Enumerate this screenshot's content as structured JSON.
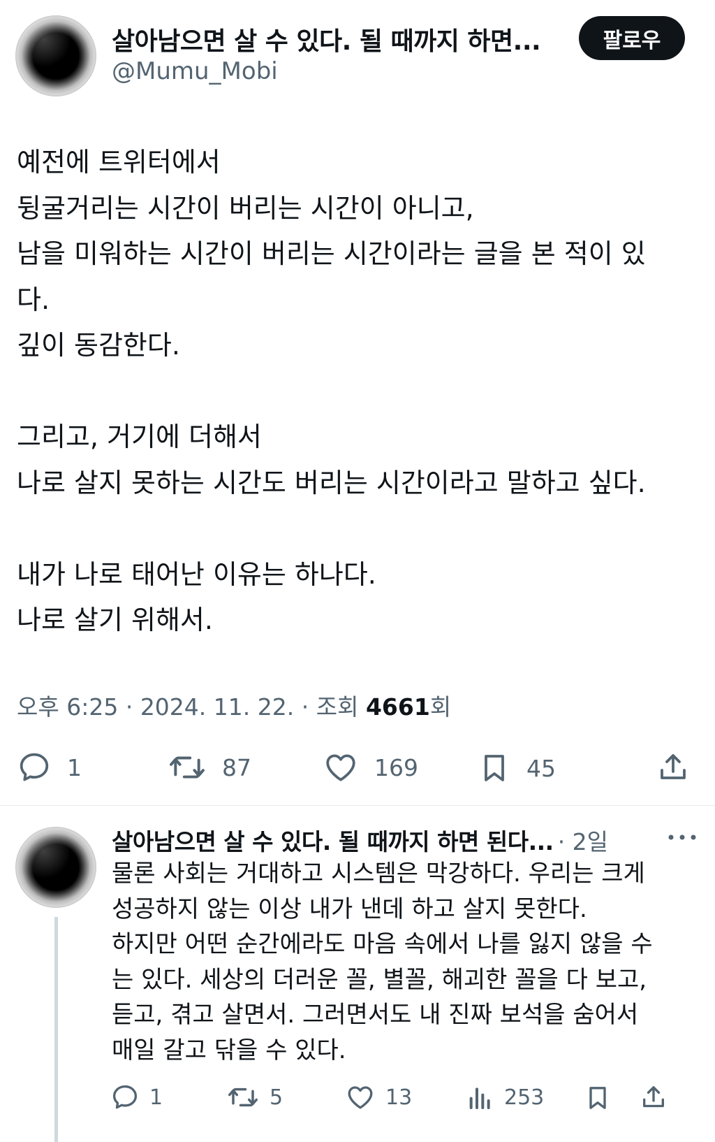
{
  "tweet": {
    "display_name": "살아남으면 살 수 있다. 될 때까지 하면...",
    "handle": "@Mumu_Mobi",
    "follow_label": "팔로우",
    "lines": [
      "예전에 트위터에서",
      "뒹굴거리는 시간이 버리는 시간이 아니고,",
      "남을 미워하는 시간이 버리는 시간이라는 글을 본 적이 있",
      "다.",
      "깊이 동감한다.",
      "",
      "그리고, 거기에 더해서",
      "나로 살지 못하는 시간도 버리는 시간이라고 말하고 싶다.",
      "",
      "내가 나로 태어난 이유는 하나다.",
      "나로 살기 위해서."
    ],
    "meta": {
      "time": "오후 6:25",
      "date": "2024. 11. 22.",
      "views_label": "조회",
      "views_count": "4661",
      "views_suffix": "회"
    },
    "actions": {
      "replies": "1",
      "retweets": "87",
      "likes": "169",
      "bookmarks": "45"
    }
  },
  "reply": {
    "display_name": "살아남으면 살 수 있다. 될 때까지 하면 된다...",
    "time": "· 2일",
    "lines": [
      "물론 사회는 거대하고 시스템은 막강하다. 우리는 크게",
      "성공하지 않는 이상 내가 낸데 하고 살지 못한다.",
      "하지만 어떤 순간에라도 마음 속에서 나를 잃지 않을 수",
      "는 있다. 세상의 더러운 꼴, 별꼴, 해괴한 꼴을 다 보고,",
      "듣고, 겪고 살면서. 그러면서도 내 진짜 보석을 숨어서",
      "매일 갈고 닦을 수 있다."
    ],
    "actions": {
      "replies": "1",
      "retweets": "5",
      "likes": "13",
      "views": "253"
    }
  },
  "icons": {
    "reply": "speech-bubble-icon",
    "retweet": "retweet-arrows-icon",
    "like": "heart-icon",
    "bookmark": "bookmark-icon",
    "share": "share-upload-icon",
    "views": "bar-chart-icon",
    "more": "more-dots-icon"
  },
  "colors": {
    "text": "#0f1419",
    "secondary": "#536471",
    "follow_bg": "#0f1419",
    "divider": "#e6e9eb",
    "thread_line": "#cfd9de"
  }
}
